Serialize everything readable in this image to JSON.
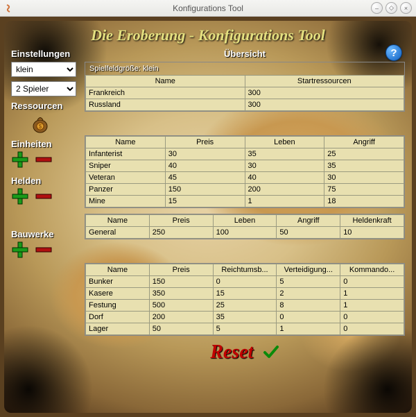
{
  "window": {
    "title": "Konfigurations Tool"
  },
  "app_title": "Die Eroberung - Konfigurations Tool",
  "side": {
    "einstellungen": "Einstellungen",
    "size_select": "klein",
    "players_select": "2 Spieler",
    "ressourcen": "Ressourcen",
    "einheiten": "Einheiten",
    "helden": "Helden",
    "bauwerke": "Bauwerke"
  },
  "overview": {
    "heading": "Übersicht",
    "fieldsize": "Spielfeldgröße: klein"
  },
  "players": {
    "headers": [
      "Name",
      "Startressourcen"
    ],
    "rows": [
      [
        "Frankreich",
        "300"
      ],
      [
        "Russland",
        "300"
      ]
    ]
  },
  "units": {
    "headers": [
      "Name",
      "Preis",
      "Leben",
      "Angriff"
    ],
    "rows": [
      [
        "Infanterist",
        "30",
        "35",
        "25"
      ],
      [
        "Sniper",
        "40",
        "30",
        "35"
      ],
      [
        "Veteran",
        "45",
        "40",
        "30"
      ],
      [
        "Panzer",
        "150",
        "200",
        "75"
      ],
      [
        "Mine",
        "15",
        "1",
        "18"
      ]
    ]
  },
  "heroes": {
    "headers": [
      "Name",
      "Preis",
      "Leben",
      "Angriff",
      "Heldenkraft"
    ],
    "rows": [
      [
        "General",
        "250",
        "100",
        "50",
        "10"
      ]
    ]
  },
  "buildings": {
    "headers": [
      "Name",
      "Preis",
      "Reichtumsb...",
      "Verteidigung...",
      "Kommando..."
    ],
    "rows": [
      [
        "Bunker",
        "150",
        "0",
        "5",
        "0"
      ],
      [
        "Kasere",
        "350",
        "15",
        "2",
        "1"
      ],
      [
        "Festung",
        "500",
        "25",
        "8",
        "1"
      ],
      [
        "Dorf",
        "200",
        "35",
        "0",
        "0"
      ],
      [
        "Lager",
        "50",
        "5",
        "1",
        "0"
      ]
    ]
  },
  "reset": "Reset",
  "help": "?"
}
